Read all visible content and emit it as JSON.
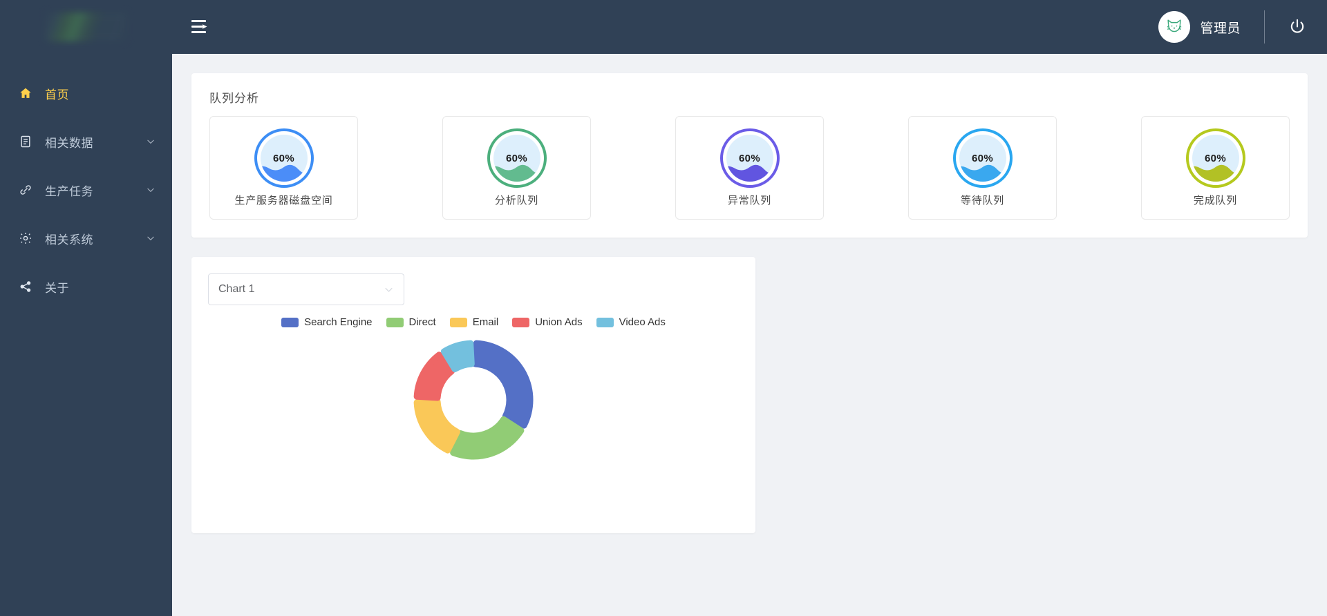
{
  "sidebar": {
    "logo_alt": "blurred-logo",
    "items": [
      {
        "label": "首页",
        "icon": "home-icon",
        "active": true,
        "expandable": false
      },
      {
        "label": "相关数据",
        "icon": "document-icon",
        "active": false,
        "expandable": true
      },
      {
        "label": "生产任务",
        "icon": "link-icon",
        "active": false,
        "expandable": true
      },
      {
        "label": "相关系统",
        "icon": "gear-icon",
        "active": false,
        "expandable": true
      },
      {
        "label": "关于",
        "icon": "share-icon",
        "active": false,
        "expandable": false
      }
    ]
  },
  "header": {
    "menu_icon": "menu-fold-icon",
    "user_name": "管理员",
    "avatar_icon": "cat-avatar-icon",
    "logout_icon": "power-icon"
  },
  "queue_panel": {
    "title": "队列分析",
    "gauges": [
      {
        "label": "生产服务器磁盘空间",
        "value": "60%",
        "percent": 60,
        "ring": "#3d8ef5",
        "fill": "#4b8df8",
        "bg": "#ddeffc"
      },
      {
        "label": "分析队列",
        "value": "60%",
        "percent": 60,
        "ring": "#4caf7d",
        "fill": "#62bb8f",
        "bg": "#ddeffc"
      },
      {
        "label": "异常队列",
        "value": "60%",
        "percent": 60,
        "ring": "#6b5ce7",
        "fill": "#6155e0",
        "bg": "#ddeffc"
      },
      {
        "label": "等待队列",
        "value": "60%",
        "percent": 60,
        "ring": "#2aa7f0",
        "fill": "#3aa8ef",
        "bg": "#ddeffc"
      },
      {
        "label": "完成队列",
        "value": "60%",
        "percent": 60,
        "ring": "#b5c91e",
        "fill": "#b2c125",
        "bg": "#ddeffc"
      }
    ]
  },
  "chart_panel": {
    "select": {
      "value": "Chart 1",
      "placeholder": "Chart 1",
      "caret": "chevron-down-icon"
    }
  },
  "chart_data": {
    "type": "pie",
    "title": "",
    "legend_position": "top",
    "labels": [
      "Search Engine",
      "Direct",
      "Email",
      "Union Ads",
      "Video Ads"
    ],
    "values": [
      1048,
      735,
      580,
      484,
      300
    ],
    "colors": [
      "#5470c6",
      "#91cc75",
      "#fac858",
      "#ee6666",
      "#73c0de"
    ],
    "inner_radius": 52,
    "outer_radius": 82,
    "rounded_corners": true,
    "gap_degrees": 6
  }
}
